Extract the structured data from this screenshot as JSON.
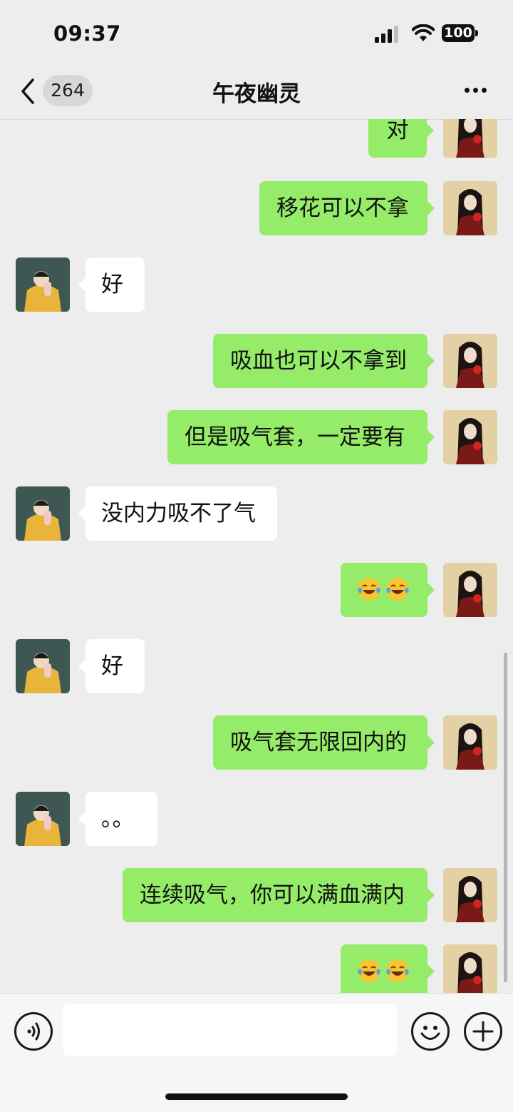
{
  "status_bar": {
    "time": "09:37",
    "battery": "100"
  },
  "header": {
    "back_count": "264",
    "title": "午夜幽灵"
  },
  "messages": [
    {
      "side": "me",
      "text": "对"
    },
    {
      "side": "me",
      "text": "移花可以不拿"
    },
    {
      "side": "other",
      "text": "好"
    },
    {
      "side": "me",
      "text": "吸血也可以不拿到"
    },
    {
      "side": "me",
      "text": "但是吸气套，一定要有"
    },
    {
      "side": "other",
      "text": "没内力吸不了气"
    },
    {
      "side": "me",
      "text": "",
      "emojis": [
        "laughing-crying-emoji",
        "laughing-crying-emoji"
      ]
    },
    {
      "side": "other",
      "text": "好"
    },
    {
      "side": "me",
      "text": "吸气套无限回内的"
    },
    {
      "side": "other",
      "text": "。。"
    },
    {
      "side": "me",
      "text": "连续吸气，你可以满血满内"
    },
    {
      "side": "me",
      "text": "",
      "emojis": [
        "laughing-crying-emoji",
        "laughing-crying-emoji"
      ]
    }
  ],
  "colors": {
    "my_bubble": "#95ec69",
    "other_bubble": "#ffffff",
    "background": "#ededed"
  }
}
